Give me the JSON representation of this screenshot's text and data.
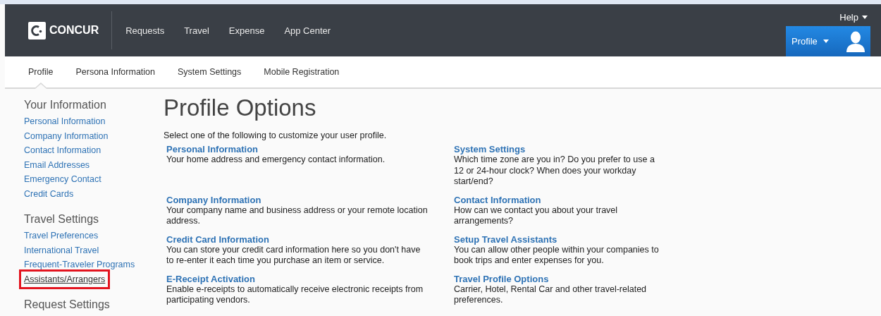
{
  "header": {
    "logo": "CONCUR",
    "nav": [
      "Requests",
      "Travel",
      "Expense",
      "App Center"
    ],
    "help": "Help",
    "profile_button": "Profile"
  },
  "subnav": [
    {
      "label": "Profile",
      "selected": true
    },
    {
      "label": "Persona Information",
      "selected": false
    },
    {
      "label": "System Settings",
      "selected": false
    },
    {
      "label": "Mobile Registration",
      "selected": false
    }
  ],
  "sidebar": [
    {
      "heading": "Your Information",
      "items": [
        {
          "label": "Personal Information",
          "highlighted": false
        },
        {
          "label": "Company Information",
          "highlighted": false
        },
        {
          "label": "Contact Information",
          "highlighted": false
        },
        {
          "label": "Email Addresses",
          "highlighted": false
        },
        {
          "label": "Emergency Contact",
          "highlighted": false
        },
        {
          "label": "Credit Cards",
          "highlighted": false
        }
      ]
    },
    {
      "heading": "Travel Settings",
      "items": [
        {
          "label": "Travel Preferences",
          "highlighted": false
        },
        {
          "label": "International Travel",
          "highlighted": false
        },
        {
          "label": "Frequent-Traveler Programs",
          "highlighted": false
        },
        {
          "label": "Assistants/Arrangers",
          "highlighted": true
        }
      ]
    },
    {
      "heading": "Request Settings"
    }
  ],
  "main": {
    "title": "Profile Options",
    "intro": "Select one of the following to customize your user profile.",
    "options": [
      {
        "title": "Personal Information",
        "description": "Your home address and emergency contact information."
      },
      {
        "title": "System Settings",
        "description": "Which time zone are you in? Do you prefer to use a 12 or 24-hour clock? When does your workday start/end?"
      },
      {
        "title": "Company Information",
        "description": "Your company name and business address or your remote location address."
      },
      {
        "title": "Contact Information",
        "description": "How can we contact you about your travel arrangements?"
      },
      {
        "title": "Credit Card Information",
        "description": "You can store your credit card information here so you don't have to re-enter it each time you purchase an item or service."
      },
      {
        "title": "Setup Travel Assistants",
        "description": "You can allow other people within your companies to book trips and enter expenses for you."
      },
      {
        "title": "E-Receipt Activation",
        "description": "Enable e-receipts to automatically receive electronic receipts from participating vendors."
      },
      {
        "title": "Travel Profile Options",
        "description": "Carrier, Hotel, Rental Car and other travel-related preferences."
      }
    ]
  }
}
